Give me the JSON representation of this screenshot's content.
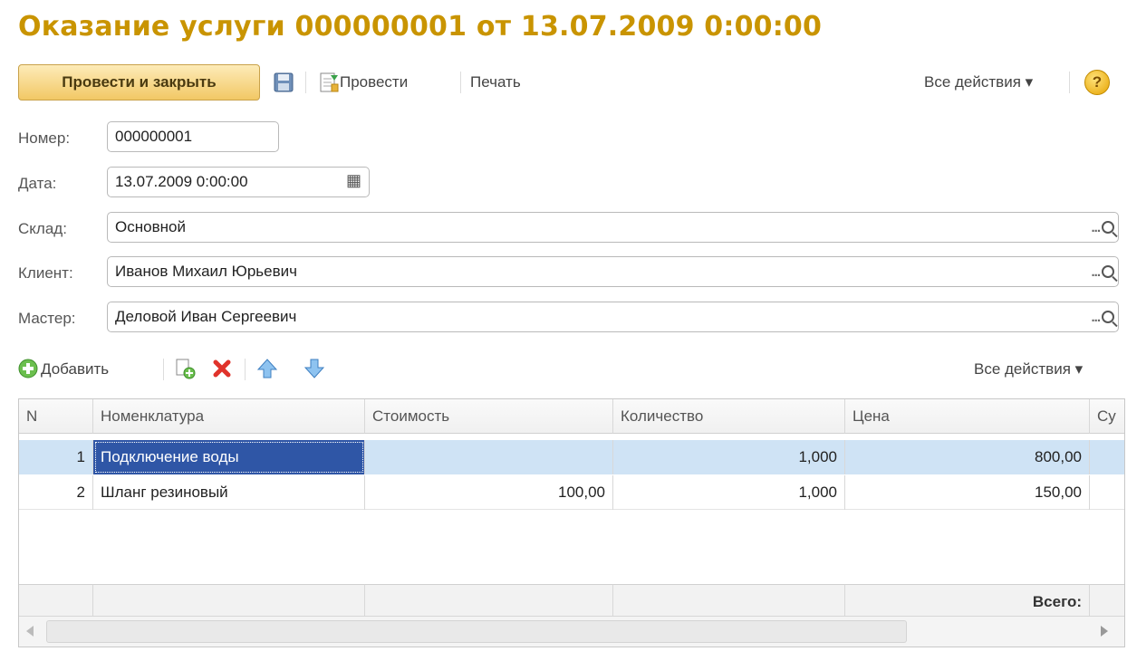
{
  "window": {
    "title": "Оказание услуги 000000001 от 13.07.2009 0:00:00"
  },
  "toolbar": {
    "post_close": "Провести и закрыть",
    "post": "Провести",
    "print": "Печать",
    "all_actions": "Все действия ▾",
    "help": "?"
  },
  "form": {
    "number_label": "Номер:",
    "number_value": "000000001",
    "date_label": "Дата:",
    "date_value": "13.07.2009  0:00:00",
    "warehouse_label": "Склад:",
    "warehouse_value": "Основной",
    "client_label": "Клиент:",
    "client_value": "Иванов Михаил Юрьевич",
    "master_label": "Мастер:",
    "master_value": "Деловой Иван Сергеевич",
    "picker_dots": "...",
    "calendar_glyph": "▦"
  },
  "table_toolbar": {
    "add": "Добавить",
    "all_actions": "Все действия ▾"
  },
  "table": {
    "columns": [
      "N",
      "Номенклатура",
      "Стоимость",
      "Количество",
      "Цена",
      "Су"
    ],
    "rows": [
      {
        "n": "1",
        "item": "Подключение воды",
        "cost": "",
        "qty": "1,000",
        "price": "800,00"
      },
      {
        "n": "2",
        "item": "Шланг резиновый",
        "cost": "100,00",
        "qty": "1,000",
        "price": "150,00"
      }
    ],
    "total_label": "Всего:"
  },
  "colors": {
    "title": "#c99400",
    "selected_row": "#cfe3f5",
    "selected_cell": "#2f56a6"
  }
}
